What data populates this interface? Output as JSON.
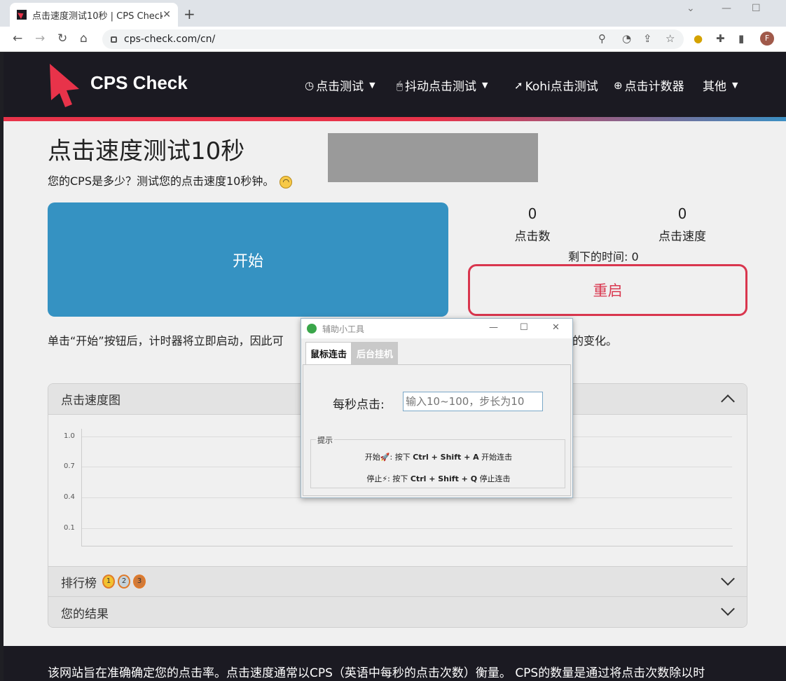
{
  "browser": {
    "tab_title": "点击速度测试10秒 | CPS Check",
    "tab_close": "✕",
    "new_tab": "+",
    "url": "cps-check.com/cn/"
  },
  "site": {
    "brand": "CPS Check",
    "menu": [
      {
        "icon": "clock-icon",
        "label": "点击测试",
        "dropdown": true
      },
      {
        "icon": "mouse-icon",
        "label": "抖动点击测试",
        "dropdown": true
      },
      {
        "icon": "cursor-icon",
        "label": "Kohi点击测试",
        "dropdown": false
      },
      {
        "icon": "plus-circle-icon",
        "label": "点击计数器",
        "dropdown": false
      },
      {
        "icon": "",
        "label": "其他",
        "dropdown": true
      }
    ],
    "page_title": "点击速度测试10秒",
    "subtitle": "您的CPS是多少？测试您的点击速度10秒钟。",
    "start_label": "开始",
    "clicks_value": "0",
    "clicks_label": "点击数",
    "speed_value": "0",
    "speed_label": "点击速度",
    "remaining": "剩下的时间: 0",
    "restart_label": "重启",
    "description_left": "单击“开始”按钮后，计时器将立即启动，因此可",
    "description_right": "的变化。",
    "chart_panel_title": "点击速度图",
    "leaderboard_title": "排行榜",
    "results_title": "您的结果",
    "footer_text": "该网站旨在准确确定您的点击率。点击速度通常以CPS（英语中每秒的点击次数）衡量。 CPS的数量是通过将点击次数除以时"
  },
  "chart_data": {
    "type": "line",
    "series": [],
    "yticks": [
      "1.0",
      "0.7",
      "0.4",
      "0.1"
    ],
    "grid": true
  },
  "dialog": {
    "title": "辅助小工具",
    "tab_active": "鼠标连击",
    "tab_inactive": "后台挂机",
    "rate_label": "每秒点击:",
    "rate_placeholder": "输入10~100，步长为10",
    "hint_legend": "提示",
    "start_hint_prefix": "开始🚀: 按下",
    "start_keys": "Ctrl + Shift + A",
    "start_hint_suffix": "开始连击",
    "stop_hint_prefix": "停止⚡: 按下",
    "stop_keys": "Ctrl + Shift + Q",
    "stop_hint_suffix": "停止连击"
  }
}
